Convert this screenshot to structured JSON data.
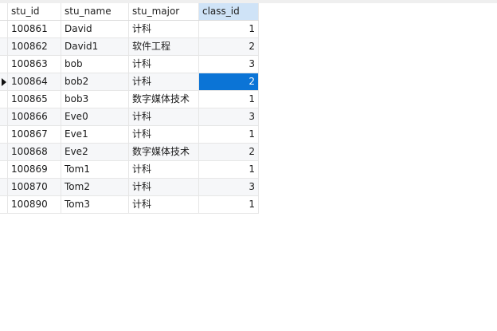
{
  "table": {
    "columns": [
      "stu_id",
      "stu_name",
      "stu_major",
      "class_id"
    ],
    "rows": [
      [
        "100861",
        "David",
        "计科",
        "1"
      ],
      [
        "100862",
        "David1",
        "软件工程",
        "2"
      ],
      [
        "100863",
        "bob",
        "计科",
        "3"
      ],
      [
        "100864",
        "bob2",
        "计科",
        "2"
      ],
      [
        "100865",
        "bob3",
        "数字媒体技术",
        "1"
      ],
      [
        "100866",
        "Eve0",
        "计科",
        "3"
      ],
      [
        "100867",
        "Eve1",
        "计科",
        "1"
      ],
      [
        "100868",
        "Eve2",
        "数字媒体技术",
        "2"
      ],
      [
        "100869",
        "Tom1",
        "计科",
        "1"
      ],
      [
        "100870",
        "Tom2",
        "计科",
        "3"
      ],
      [
        "100890",
        "Tom3",
        "计科",
        "1"
      ]
    ],
    "current_row": 3,
    "selected_column": 3,
    "colors": {
      "selection": "#0b74d6",
      "sorted_header": "#cfe3f7",
      "alt_row": "#f6f7f9"
    }
  }
}
